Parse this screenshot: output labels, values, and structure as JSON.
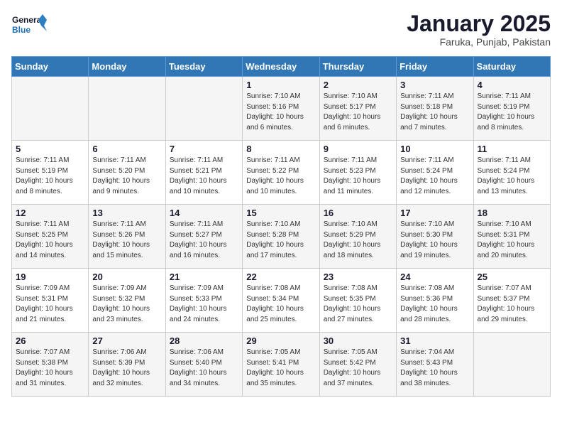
{
  "header": {
    "logo_line1": "General",
    "logo_line2": "Blue",
    "month_year": "January 2025",
    "location": "Faruka, Punjab, Pakistan"
  },
  "weekdays": [
    "Sunday",
    "Monday",
    "Tuesday",
    "Wednesday",
    "Thursday",
    "Friday",
    "Saturday"
  ],
  "weeks": [
    [
      {
        "day": "",
        "sunrise": "",
        "sunset": "",
        "daylight": ""
      },
      {
        "day": "",
        "sunrise": "",
        "sunset": "",
        "daylight": ""
      },
      {
        "day": "",
        "sunrise": "",
        "sunset": "",
        "daylight": ""
      },
      {
        "day": "1",
        "sunrise": "Sunrise: 7:10 AM",
        "sunset": "Sunset: 5:16 PM",
        "daylight": "Daylight: 10 hours and 6 minutes."
      },
      {
        "day": "2",
        "sunrise": "Sunrise: 7:10 AM",
        "sunset": "Sunset: 5:17 PM",
        "daylight": "Daylight: 10 hours and 6 minutes."
      },
      {
        "day": "3",
        "sunrise": "Sunrise: 7:11 AM",
        "sunset": "Sunset: 5:18 PM",
        "daylight": "Daylight: 10 hours and 7 minutes."
      },
      {
        "day": "4",
        "sunrise": "Sunrise: 7:11 AM",
        "sunset": "Sunset: 5:19 PM",
        "daylight": "Daylight: 10 hours and 8 minutes."
      }
    ],
    [
      {
        "day": "5",
        "sunrise": "Sunrise: 7:11 AM",
        "sunset": "Sunset: 5:19 PM",
        "daylight": "Daylight: 10 hours and 8 minutes."
      },
      {
        "day": "6",
        "sunrise": "Sunrise: 7:11 AM",
        "sunset": "Sunset: 5:20 PM",
        "daylight": "Daylight: 10 hours and 9 minutes."
      },
      {
        "day": "7",
        "sunrise": "Sunrise: 7:11 AM",
        "sunset": "Sunset: 5:21 PM",
        "daylight": "Daylight: 10 hours and 10 minutes."
      },
      {
        "day": "8",
        "sunrise": "Sunrise: 7:11 AM",
        "sunset": "Sunset: 5:22 PM",
        "daylight": "Daylight: 10 hours and 10 minutes."
      },
      {
        "day": "9",
        "sunrise": "Sunrise: 7:11 AM",
        "sunset": "Sunset: 5:23 PM",
        "daylight": "Daylight: 10 hours and 11 minutes."
      },
      {
        "day": "10",
        "sunrise": "Sunrise: 7:11 AM",
        "sunset": "Sunset: 5:24 PM",
        "daylight": "Daylight: 10 hours and 12 minutes."
      },
      {
        "day": "11",
        "sunrise": "Sunrise: 7:11 AM",
        "sunset": "Sunset: 5:24 PM",
        "daylight": "Daylight: 10 hours and 13 minutes."
      }
    ],
    [
      {
        "day": "12",
        "sunrise": "Sunrise: 7:11 AM",
        "sunset": "Sunset: 5:25 PM",
        "daylight": "Daylight: 10 hours and 14 minutes."
      },
      {
        "day": "13",
        "sunrise": "Sunrise: 7:11 AM",
        "sunset": "Sunset: 5:26 PM",
        "daylight": "Daylight: 10 hours and 15 minutes."
      },
      {
        "day": "14",
        "sunrise": "Sunrise: 7:11 AM",
        "sunset": "Sunset: 5:27 PM",
        "daylight": "Daylight: 10 hours and 16 minutes."
      },
      {
        "day": "15",
        "sunrise": "Sunrise: 7:10 AM",
        "sunset": "Sunset: 5:28 PM",
        "daylight": "Daylight: 10 hours and 17 minutes."
      },
      {
        "day": "16",
        "sunrise": "Sunrise: 7:10 AM",
        "sunset": "Sunset: 5:29 PM",
        "daylight": "Daylight: 10 hours and 18 minutes."
      },
      {
        "day": "17",
        "sunrise": "Sunrise: 7:10 AM",
        "sunset": "Sunset: 5:30 PM",
        "daylight": "Daylight: 10 hours and 19 minutes."
      },
      {
        "day": "18",
        "sunrise": "Sunrise: 7:10 AM",
        "sunset": "Sunset: 5:31 PM",
        "daylight": "Daylight: 10 hours and 20 minutes."
      }
    ],
    [
      {
        "day": "19",
        "sunrise": "Sunrise: 7:09 AM",
        "sunset": "Sunset: 5:31 PM",
        "daylight": "Daylight: 10 hours and 21 minutes."
      },
      {
        "day": "20",
        "sunrise": "Sunrise: 7:09 AM",
        "sunset": "Sunset: 5:32 PM",
        "daylight": "Daylight: 10 hours and 23 minutes."
      },
      {
        "day": "21",
        "sunrise": "Sunrise: 7:09 AM",
        "sunset": "Sunset: 5:33 PM",
        "daylight": "Daylight: 10 hours and 24 minutes."
      },
      {
        "day": "22",
        "sunrise": "Sunrise: 7:08 AM",
        "sunset": "Sunset: 5:34 PM",
        "daylight": "Daylight: 10 hours and 25 minutes."
      },
      {
        "day": "23",
        "sunrise": "Sunrise: 7:08 AM",
        "sunset": "Sunset: 5:35 PM",
        "daylight": "Daylight: 10 hours and 27 minutes."
      },
      {
        "day": "24",
        "sunrise": "Sunrise: 7:08 AM",
        "sunset": "Sunset: 5:36 PM",
        "daylight": "Daylight: 10 hours and 28 minutes."
      },
      {
        "day": "25",
        "sunrise": "Sunrise: 7:07 AM",
        "sunset": "Sunset: 5:37 PM",
        "daylight": "Daylight: 10 hours and 29 minutes."
      }
    ],
    [
      {
        "day": "26",
        "sunrise": "Sunrise: 7:07 AM",
        "sunset": "Sunset: 5:38 PM",
        "daylight": "Daylight: 10 hours and 31 minutes."
      },
      {
        "day": "27",
        "sunrise": "Sunrise: 7:06 AM",
        "sunset": "Sunset: 5:39 PM",
        "daylight": "Daylight: 10 hours and 32 minutes."
      },
      {
        "day": "28",
        "sunrise": "Sunrise: 7:06 AM",
        "sunset": "Sunset: 5:40 PM",
        "daylight": "Daylight: 10 hours and 34 minutes."
      },
      {
        "day": "29",
        "sunrise": "Sunrise: 7:05 AM",
        "sunset": "Sunset: 5:41 PM",
        "daylight": "Daylight: 10 hours and 35 minutes."
      },
      {
        "day": "30",
        "sunrise": "Sunrise: 7:05 AM",
        "sunset": "Sunset: 5:42 PM",
        "daylight": "Daylight: 10 hours and 37 minutes."
      },
      {
        "day": "31",
        "sunrise": "Sunrise: 7:04 AM",
        "sunset": "Sunset: 5:43 PM",
        "daylight": "Daylight: 10 hours and 38 minutes."
      },
      {
        "day": "",
        "sunrise": "",
        "sunset": "",
        "daylight": ""
      }
    ]
  ]
}
